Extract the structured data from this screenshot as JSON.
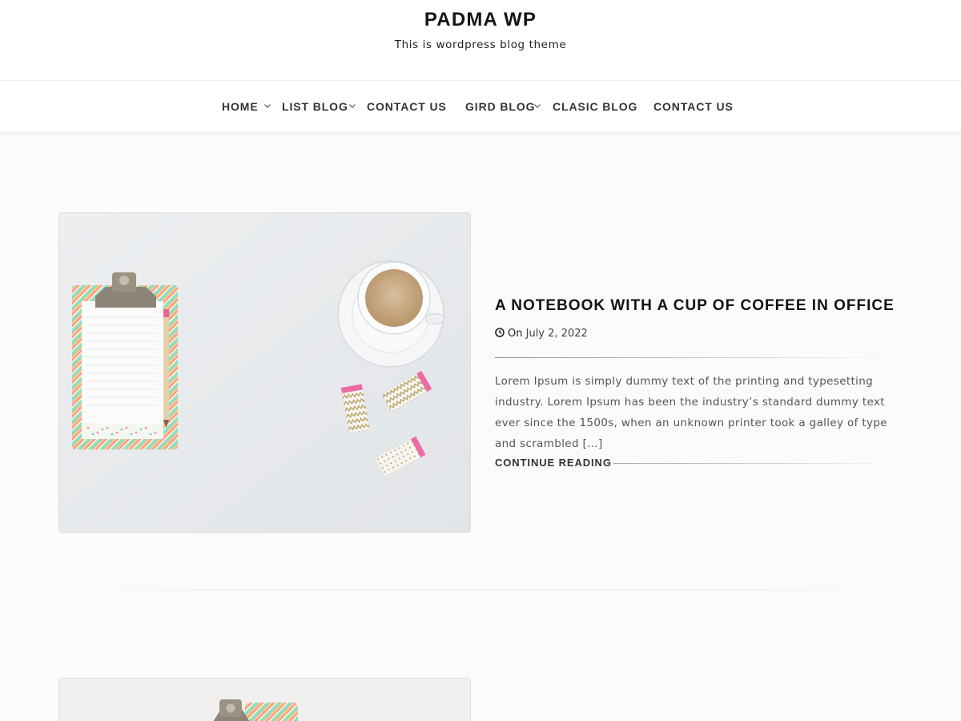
{
  "site": {
    "title": "PADMA WP",
    "tagline": "This is wordpress blog theme"
  },
  "nav": {
    "items": [
      {
        "label": "HOME",
        "has_dropdown": true
      },
      {
        "label": "LIST BLOG",
        "has_dropdown": true
      },
      {
        "label": "CONTACT US",
        "has_dropdown": false
      },
      {
        "label": "GIRD BLOG",
        "has_dropdown": true
      },
      {
        "label": "CLASIC BLOG",
        "has_dropdown": false
      },
      {
        "label": "CONTACT US",
        "has_dropdown": false
      }
    ],
    "dropdown_icon": "chevron-down-icon"
  },
  "post": {
    "title": "A NOTEBOOK WITH A CUP OF COFFEE IN OFFICE",
    "meta_icon": "clock-icon",
    "meta_prefix": "On",
    "date": "July 2, 2022",
    "excerpt": "Lorem Ipsum is simply dummy text of the printing and typesetting industry. Lorem Ipsum has been the industry’s standard dummy text ever since the 1500s, when an unknown printer took a galley of type and scrambled […]",
    "continue_label": "CONTINUE READING"
  },
  "colors": {
    "background": "#fbfbfb",
    "header_background": "#ffffff",
    "title_text": "#111111",
    "body_text": "#555555"
  }
}
